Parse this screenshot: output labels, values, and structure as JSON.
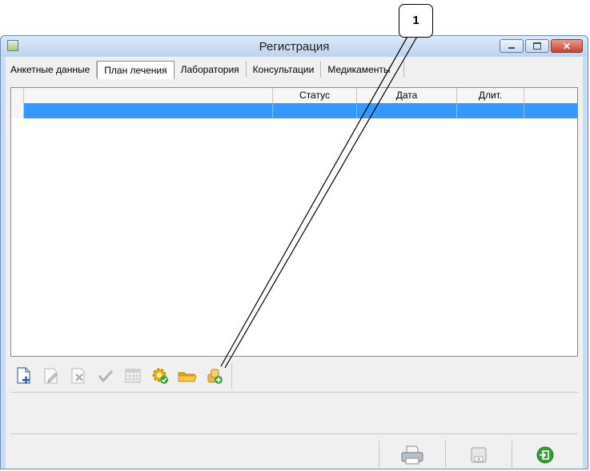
{
  "window": {
    "title": "Регистрация"
  },
  "tabs": [
    {
      "label": "Анкетные данные"
    },
    {
      "label": "План лечения"
    },
    {
      "label": "Лаборатория"
    },
    {
      "label": "Консультации"
    },
    {
      "label": "Медикаменты"
    }
  ],
  "grid": {
    "columns": [
      {
        "label": ""
      },
      {
        "label": "Статус"
      },
      {
        "label": "Дата"
      },
      {
        "label": "Длит."
      },
      {
        "label": ""
      }
    ]
  },
  "toolbar": {
    "icons": [
      "add-document-icon",
      "edit-icon",
      "delete-icon",
      "check-icon",
      "calendar-icon",
      "settings-icon",
      "folder-icon",
      "coins-add-icon"
    ]
  },
  "bottom": {
    "icons": [
      "print-icon",
      "save-icon",
      "exit-icon"
    ]
  },
  "callout": {
    "label": "1"
  },
  "colors": {
    "selection": "#3399ff",
    "window_frame": "#c9dcf2",
    "close_button": "#c5432f"
  }
}
